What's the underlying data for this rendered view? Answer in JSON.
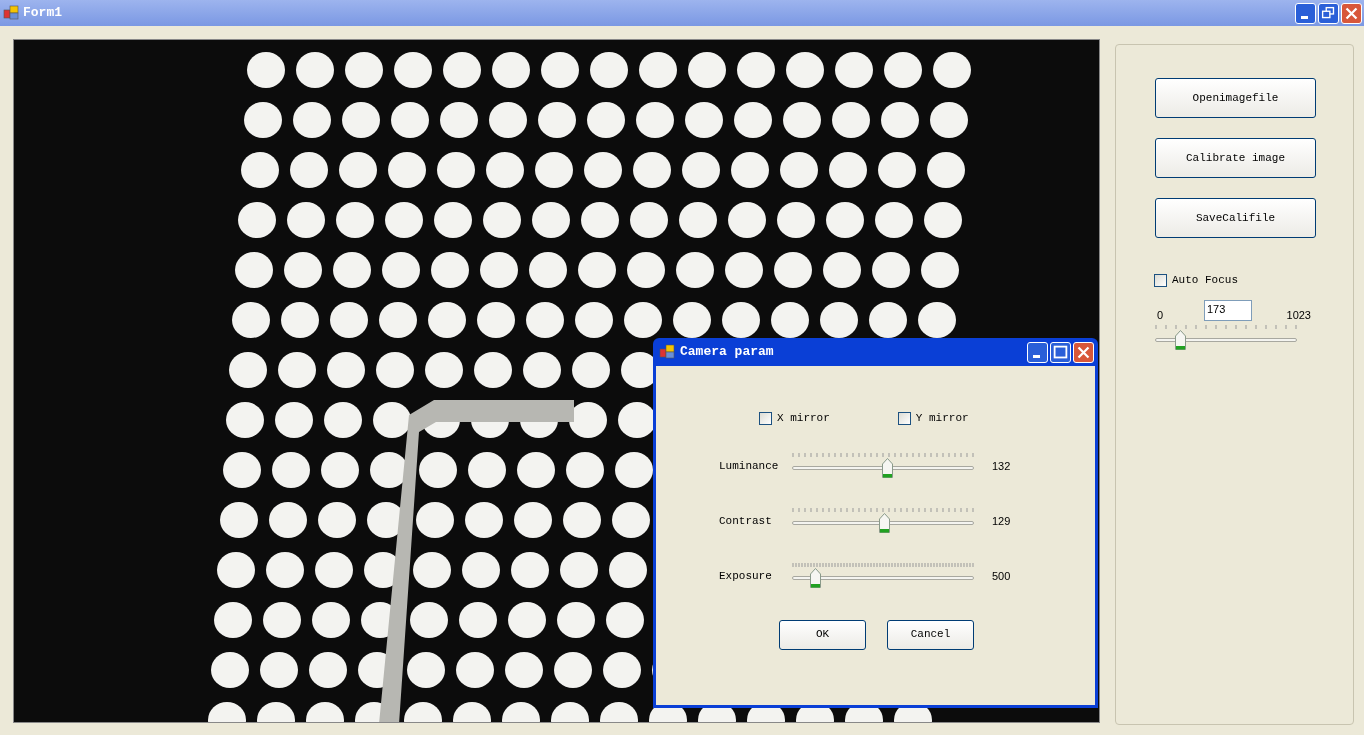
{
  "window": {
    "title": "Form1"
  },
  "side_panel": {
    "buttons": [
      "Openimagefile",
      "Calibrate image",
      "SaveCalifile"
    ],
    "auto_focus": {
      "label": "Auto Focus",
      "checked": false
    },
    "focus": {
      "min": "0",
      "max": "1023",
      "value": "173",
      "level": 0.17
    }
  },
  "dialog": {
    "title": "Camera param",
    "checkboxes": [
      {
        "label": "X mirror",
        "checked": false
      },
      {
        "label": "Y mirror",
        "checked": false
      }
    ],
    "sliders": [
      {
        "label": "Luminance",
        "level": 0.52,
        "reading": "132"
      },
      {
        "label": "Contrast",
        "level": 0.505,
        "reading": "129"
      },
      {
        "label": "Exposure",
        "level": 0.12,
        "reading": "500"
      }
    ],
    "buttons": [
      "OK",
      "Cancel"
    ]
  }
}
